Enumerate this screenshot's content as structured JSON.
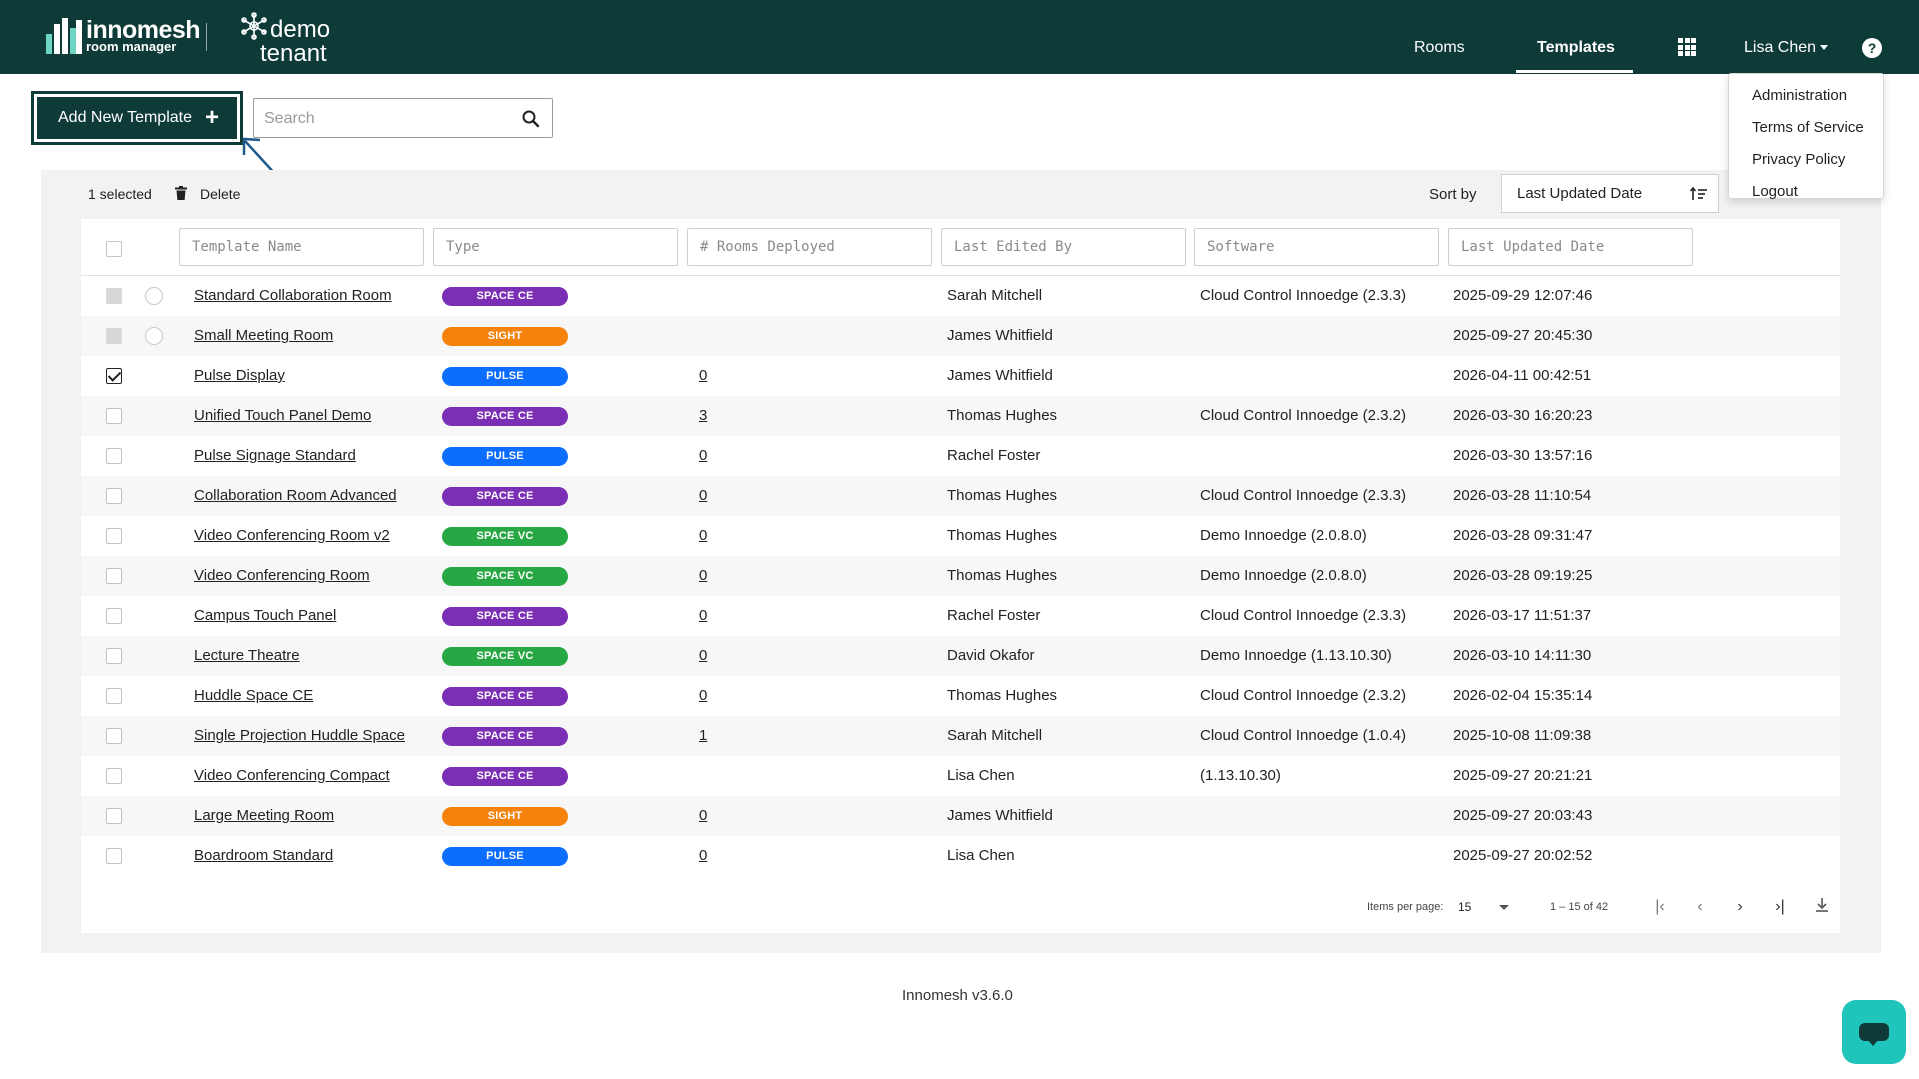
{
  "brand": {
    "logo_name": "innomesh",
    "logo_sub": "room manager",
    "tenant_line1": "demo",
    "tenant_line2": "tenant"
  },
  "nav": {
    "rooms": "Rooms",
    "templates": "Templates",
    "user": "Lisa Chen",
    "help": "?"
  },
  "user_dropdown": [
    "Administration",
    "Terms of Service",
    "Privacy Policy",
    "Logout"
  ],
  "toolbar": {
    "add_label": "Add New Template",
    "search_placeholder": "Search"
  },
  "actions": {
    "selected_count": "1 selected",
    "delete_label": "Delete",
    "sort_by_label": "Sort by",
    "sort_value": "Last Updated Date"
  },
  "columns": [
    "Template Name",
    "Type",
    "# Rooms Deployed",
    "Last Edited By",
    "Software",
    "Last Updated Date"
  ],
  "badge_colors": {
    "SPACE CE": "#7b2fb5",
    "SIGHT": "#f5820d",
    "PULSE": "#0d6efd",
    "SPACE VC": "#28a745"
  },
  "rows": [
    {
      "name": "Standard Collaboration Room",
      "type": "SPACE CE",
      "rooms": "",
      "editor": "Sarah Mitchell",
      "software": "Cloud Control Innoedge (2.3.3)",
      "date": "2025-09-29 12:07:46",
      "state": "disabled"
    },
    {
      "name": "Small Meeting Room",
      "type": "SIGHT",
      "rooms": "",
      "editor": "James Whitfield",
      "software": "",
      "date": "2025-09-27 20:45:30",
      "state": "disabled"
    },
    {
      "name": "Pulse Display",
      "type": "PULSE",
      "rooms": "0",
      "editor": "James Whitfield",
      "software": "",
      "date": "2026-04-11 00:42:51",
      "state": "checked"
    },
    {
      "name": "Unified Touch Panel Demo",
      "type": "SPACE CE",
      "rooms": "3",
      "editor": "Thomas Hughes",
      "software": "Cloud Control Innoedge (2.3.2)",
      "date": "2026-03-30 16:20:23",
      "state": "empty"
    },
    {
      "name": "Pulse Signage Standard",
      "type": "PULSE",
      "rooms": "0",
      "editor": "Rachel Foster",
      "software": "",
      "date": "2026-03-30 13:57:16",
      "state": "empty"
    },
    {
      "name": "Collaboration Room Advanced",
      "type": "SPACE CE",
      "rooms": "0",
      "editor": "Thomas Hughes",
      "software": "Cloud Control Innoedge (2.3.3)",
      "date": "2026-03-28 11:10:54",
      "state": "empty"
    },
    {
      "name": "Video Conferencing Room v2",
      "type": "SPACE VC",
      "rooms": "0",
      "editor": "Thomas Hughes",
      "software": "Demo Innoedge (2.0.8.0)",
      "date": "2026-03-28 09:31:47",
      "state": "empty"
    },
    {
      "name": "Video Conferencing Room",
      "type": "SPACE VC",
      "rooms": "0",
      "editor": "Thomas Hughes",
      "software": "Demo Innoedge (2.0.8.0)",
      "date": "2026-03-28 09:19:25",
      "state": "empty"
    },
    {
      "name": "Campus Touch Panel",
      "type": "SPACE CE",
      "rooms": "0",
      "editor": "Rachel Foster",
      "software": "Cloud Control Innoedge (2.3.3)",
      "date": "2026-03-17 11:51:37",
      "state": "empty"
    },
    {
      "name": "Lecture Theatre",
      "type": "SPACE VC",
      "rooms": "0",
      "editor": "David Okafor",
      "software": "Demo Innoedge (1.13.10.30)",
      "date": "2026-03-10 14:11:30",
      "state": "empty"
    },
    {
      "name": "Huddle Space CE",
      "type": "SPACE CE",
      "rooms": "0",
      "editor": "Thomas Hughes",
      "software": "Cloud Control Innoedge (2.3.2)",
      "date": "2026-02-04 15:35:14",
      "state": "empty"
    },
    {
      "name": "Single Projection Huddle Space",
      "type": "SPACE CE",
      "rooms": "1",
      "editor": "Sarah Mitchell",
      "software": "Cloud Control Innoedge (1.0.4)",
      "date": "2025-10-08 11:09:38",
      "state": "empty"
    },
    {
      "name": "Video Conferencing Compact",
      "type": "SPACE CE",
      "rooms": "",
      "editor": "Lisa Chen",
      "software": "(1.13.10.30)",
      "date": "2025-09-27 20:21:21",
      "state": "empty"
    },
    {
      "name": "Large Meeting Room",
      "type": "SIGHT",
      "rooms": "0",
      "editor": "James Whitfield",
      "software": "",
      "date": "2025-09-27 20:03:43",
      "state": "empty"
    },
    {
      "name": "Boardroom Standard",
      "type": "PULSE",
      "rooms": "0",
      "editor": "Lisa Chen",
      "software": "",
      "date": "2025-09-27 20:02:52",
      "state": "empty"
    }
  ],
  "pagination": {
    "items_per_page_label": "Items per page:",
    "items_per_page": "15",
    "range": "1 – 15 of 42"
  },
  "footer": {
    "version": "Innomesh v3.6.0"
  },
  "colors": {
    "header_bg": "#0e3a37",
    "chat_button": "#1fc5bb"
  }
}
